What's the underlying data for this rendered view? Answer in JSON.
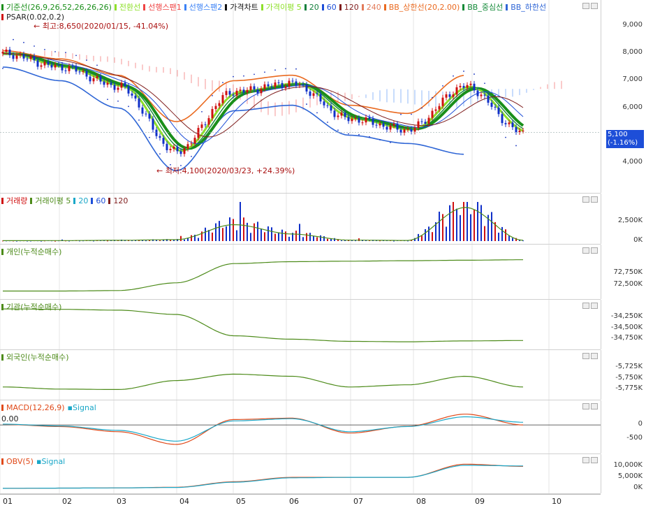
{
  "colors": {
    "up": "#d01010",
    "down": "#1030c8",
    "kijun": "#1a8f1a",
    "tenkan": "#8ee02a",
    "span1": "#ef4444",
    "span2": "#3b82f6",
    "bbUpper": "#ea6a20",
    "bbMid": "#138a38",
    "bbLower": "#2f66d6",
    "ma5": "#8ee02a",
    "ma20": "#15803d",
    "ma60": "#1d4ed8",
    "ma120": "#7f1d1d",
    "ma240": "#e37b5a",
    "psar": "#1a35c0",
    "indicator": "#4d8b1a",
    "macd": "#e04a1a",
    "signal": "#1aa7c8"
  },
  "price_panel": {
    "legend": [
      {
        "text": "기준선(26,9,26,52,26,26,26)",
        "color": "#1a8f1a"
      },
      {
        "text": "전환선",
        "color": "#8ee02a"
      },
      {
        "text": "선행스팬1",
        "color": "#ef4444"
      },
      {
        "text": "선행스팬2",
        "color": "#3b82f6"
      },
      {
        "text": "가격차트",
        "color": "#111111"
      },
      {
        "text": "가격이평 5",
        "color": "#8ee02a"
      },
      {
        "text": "20",
        "color": "#15803d"
      },
      {
        "text": "60",
        "color": "#1d4ed8"
      },
      {
        "text": "120",
        "color": "#7f1d1d"
      },
      {
        "text": "240",
        "color": "#e37b5a"
      },
      {
        "text": "BB_상한선(20,2.00)",
        "color": "#ea6a20"
      },
      {
        "text": "BB_중심선",
        "color": "#138a38"
      },
      {
        "text": "BB_하한선",
        "color": "#2f66d6"
      }
    ],
    "psar_label": "PSAR(0.02,0.2)",
    "high_note": "← 최고:8,650(2020/01/15, -41.04%)",
    "low_note": "← 최저:4,100(2020/03/23, +24.39%)",
    "last_price": "5,100",
    "last_change": "(-1.16%)"
  },
  "volume_panel": {
    "legend": [
      {
        "text": "거래량",
        "color": "#d01010"
      },
      {
        "text": "거래이평 5",
        "color": "#4d8b1a"
      },
      {
        "text": "20",
        "color": "#1aa7c8"
      },
      {
        "text": "60",
        "color": "#1d4ed8"
      },
      {
        "text": "120",
        "color": "#7f1d1d"
      }
    ]
  },
  "individual_panel": {
    "legend": "개인(누적순매수)"
  },
  "institution_panel": {
    "legend": "기관(누적순매수)"
  },
  "foreign_panel": {
    "legend": "외국인(누적순매수)"
  },
  "macd_panel": {
    "legend_macd": "MACD(12,26,9)",
    "legend_signal": "Signal",
    "corner_value": "0.00"
  },
  "obv_panel": {
    "legend_obv": "OBV(5)",
    "legend_signal": "Signal"
  },
  "x_labels": [
    "01",
    "02",
    "03",
    "04",
    "05",
    "06",
    "07",
    "08",
    "09",
    "10"
  ],
  "chart_data": [
    {
      "type": "line",
      "title": "가격차트",
      "y_ticks": [
        "9,000",
        "8,000",
        "7,000",
        "6,000",
        "4,000"
      ],
      "ylim": [
        3400,
        9600
      ],
      "x": [
        "01",
        "02",
        "03",
        "04",
        "05",
        "06",
        "07",
        "08",
        "09",
        "10"
      ],
      "series": [
        {
          "name": "가격차트",
          "values": [
            8000,
            7500,
            6800,
            4400,
            6600,
            6900,
            5600,
            5200,
            6800,
            5100
          ]
        },
        {
          "name": "BB_상한선",
          "values": [
            8100,
            7800,
            7200,
            5500,
            7000,
            7200,
            6100,
            5800,
            7200,
            null
          ]
        },
        {
          "name": "BB_하한선",
          "values": [
            7500,
            7000,
            6000,
            3700,
            5900,
            6100,
            5000,
            4700,
            4300,
            null
          ]
        }
      ]
    },
    {
      "type": "bar",
      "title": "거래량",
      "y_ticks": [
        "2,500K",
        "0K"
      ],
      "ylim": [
        0,
        5000
      ],
      "x": [
        "01",
        "02",
        "03",
        "04",
        "05",
        "06",
        "07",
        "08",
        "09",
        "10"
      ],
      "series": [
        {
          "name": "거래량",
          "values": [
            50,
            60,
            100,
            180,
            2100,
            900,
            120,
            80,
            4300,
            100
          ]
        }
      ]
    },
    {
      "type": "line",
      "title": "개인(누적순매수)",
      "y_ticks": [
        "72,750K",
        "72,500K"
      ],
      "ylim": [
        72300,
        73200
      ],
      "series": [
        {
          "name": "개인(누적순매수)",
          "values": [
            72380,
            72380,
            72390,
            72550,
            72950,
            72990,
            73000,
            73010,
            73020,
            73030
          ]
        }
      ]
    },
    {
      "type": "line",
      "title": "기관(누적순매수)",
      "y_ticks": [
        "-34,250K",
        "-34,500K",
        "-34,750K"
      ],
      "ylim": [
        -34900,
        -34000
      ],
      "series": [
        {
          "name": "기관(누적순매수)",
          "values": [
            -34050,
            -34060,
            -34080,
            -34180,
            -34680,
            -34760,
            -34810,
            -34820,
            -34800,
            -34790
          ]
        }
      ]
    },
    {
      "type": "line",
      "title": "외국인(누적순매수)",
      "y_ticks": [
        "-5,725K",
        "-5,750K",
        "-5,775K"
      ],
      "ylim": [
        -5790,
        -5700
      ],
      "series": [
        {
          "name": "외국인(누적순매수)",
          "values": [
            -5770,
            -5775,
            -5776,
            -5755,
            -5740,
            -5745,
            -5770,
            -5765,
            -5745,
            -5770
          ]
        }
      ]
    },
    {
      "type": "line",
      "title": "MACD(12,26,9)",
      "y_ticks": [
        "0",
        "-500"
      ],
      "ylim": [
        -900,
        700
      ],
      "series": [
        {
          "name": "MACD(12,26,9)",
          "values": [
            20,
            -60,
            -250,
            -720,
            200,
            250,
            -300,
            -50,
            400,
            0
          ]
        },
        {
          "name": "Signal",
          "values": [
            30,
            -40,
            -200,
            -600,
            150,
            230,
            -250,
            -60,
            300,
            100
          ]
        }
      ]
    },
    {
      "type": "line",
      "title": "OBV(5)",
      "y_ticks": [
        "10,000K",
        "5,000K",
        "0K"
      ],
      "ylim": [
        -1000,
        13000
      ],
      "series": [
        {
          "name": "OBV(5)",
          "values": [
            0,
            100,
            200,
            500,
            3000,
            5000,
            5000,
            5000,
            11000,
            10000
          ]
        },
        {
          "name": "Signal",
          "values": [
            0,
            100,
            200,
            400,
            2800,
            4800,
            5000,
            5000,
            10500,
            10200
          ]
        }
      ]
    }
  ]
}
